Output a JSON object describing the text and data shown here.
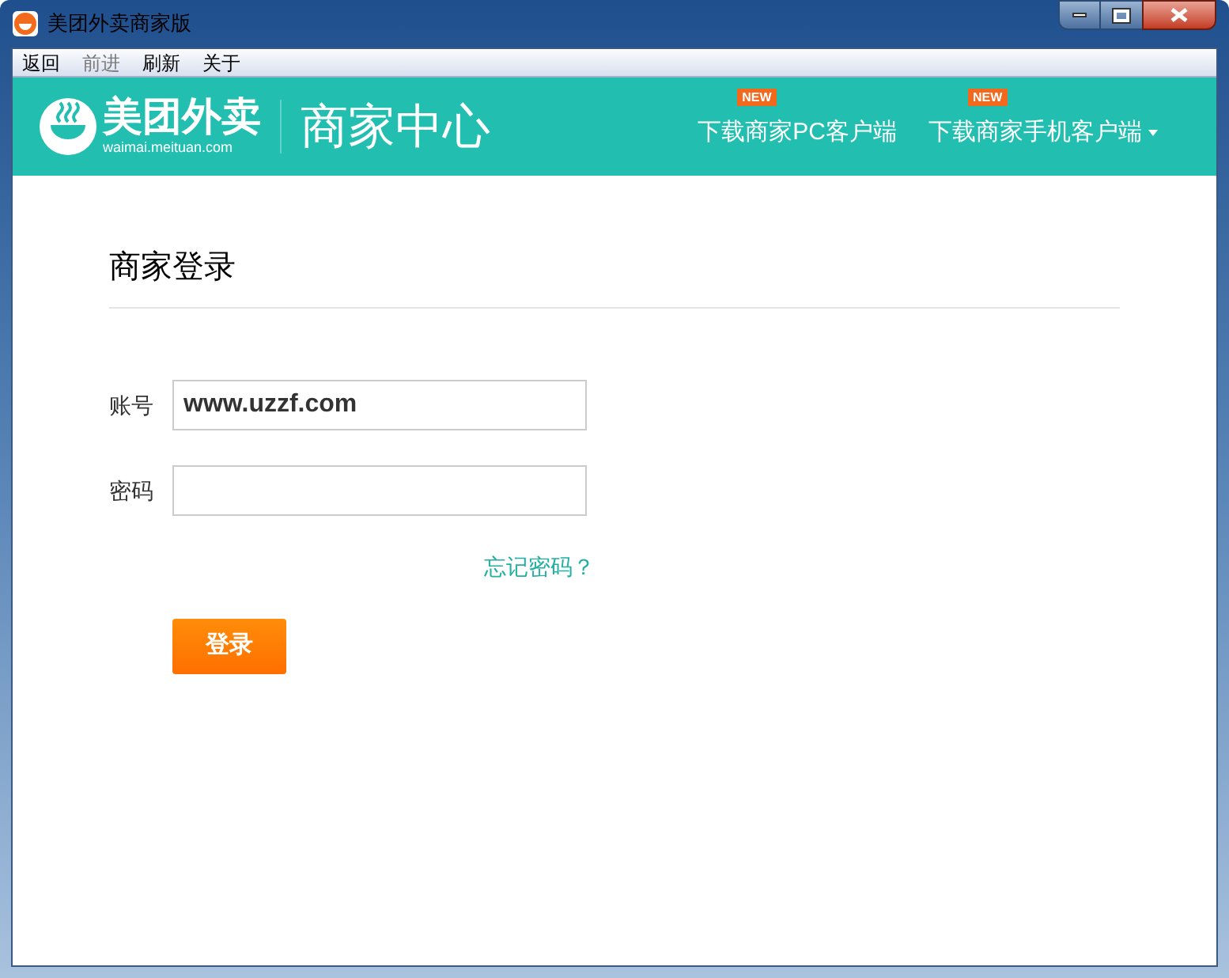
{
  "window": {
    "title": "美团外卖商家版"
  },
  "menu": [
    {
      "label": "返回",
      "disabled": false
    },
    {
      "label": "前进",
      "disabled": true
    },
    {
      "label": "刷新",
      "disabled": false
    },
    {
      "label": "关于",
      "disabled": false
    }
  ],
  "header": {
    "brand": "美团外卖",
    "domain": "waimai.meituan.com",
    "section": "商家中心",
    "links": [
      {
        "label": "下载商家PC客户端",
        "badge": "NEW",
        "dropdown": false
      },
      {
        "label": "下载商家手机客户端",
        "badge": "NEW",
        "dropdown": true
      }
    ]
  },
  "login": {
    "title": "商家登录",
    "fields": [
      {
        "label": "账号",
        "value": "www.uzzf.com"
      },
      {
        "label": "密码"
      }
    ],
    "forgot": "忘记密码？",
    "submit": "登录"
  }
}
